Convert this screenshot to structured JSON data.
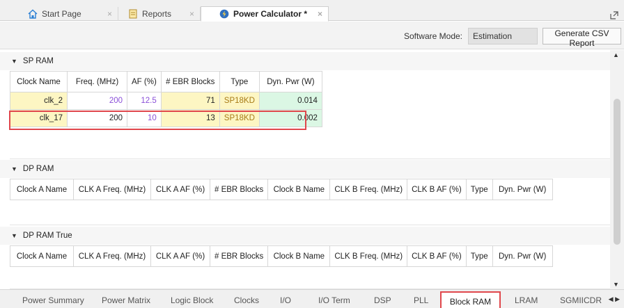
{
  "tabs": [
    {
      "label": "Start Page",
      "icon": "home-icon",
      "active": false
    },
    {
      "label": "Reports",
      "icon": "report-icon",
      "active": false
    },
    {
      "label": "Power Calculator *",
      "icon": "power-calculator-icon",
      "active": true
    }
  ],
  "tab_close": "×",
  "toolbar": {
    "software_mode_label": "Software Mode:",
    "software_mode_value": "Estimation",
    "csv_button": "Generate CSV Report"
  },
  "sp_ram": {
    "title": "SP RAM",
    "headers": [
      "Clock Name",
      "Freq. (MHz)",
      "AF (%)",
      "# EBR Blocks",
      "Type",
      "Dyn. Pwr (W)"
    ],
    "rows": [
      {
        "clock": "clk_2",
        "freq": "200",
        "af": "12.5",
        "ebr": "71",
        "type": "SP18KD",
        "pwr": "0.014"
      },
      {
        "clock": "clk_17",
        "freq": "200",
        "af": "10",
        "ebr": "13",
        "type": "SP18KD",
        "pwr": "0.002"
      }
    ]
  },
  "dp_ram": {
    "title": "DP RAM",
    "headers": [
      "Clock A Name",
      "CLK A Freq. (MHz)",
      "CLK A AF (%)",
      "# EBR Blocks",
      "Clock B Name",
      "CLK B Freq. (MHz)",
      "CLK B AF (%)",
      "Type",
      "Dyn. Pwr (W)"
    ]
  },
  "dp_ram_true": {
    "title": "DP RAM True",
    "headers": [
      "Clock A Name",
      "CLK A Freq. (MHz)",
      "CLK A AF (%)",
      "# EBR Blocks",
      "Clock B Name",
      "CLK B Freq. (MHz)",
      "CLK B AF (%)",
      "Type",
      "Dyn. Pwr (W)"
    ]
  },
  "bottom_tabs": [
    "Power Summary",
    "Power Matrix",
    "Logic Block",
    "Clocks",
    "I/O",
    "I/O Term",
    "DSP",
    "PLL",
    "Block RAM",
    "LRAM",
    "SGMIICDR"
  ],
  "bottom_active": "Block RAM",
  "colors": {
    "selection": "#e0474c",
    "input_yellow": "#fdf6c3",
    "output_green": "#dbf7e4",
    "value_purple": "#8a4fd8"
  }
}
